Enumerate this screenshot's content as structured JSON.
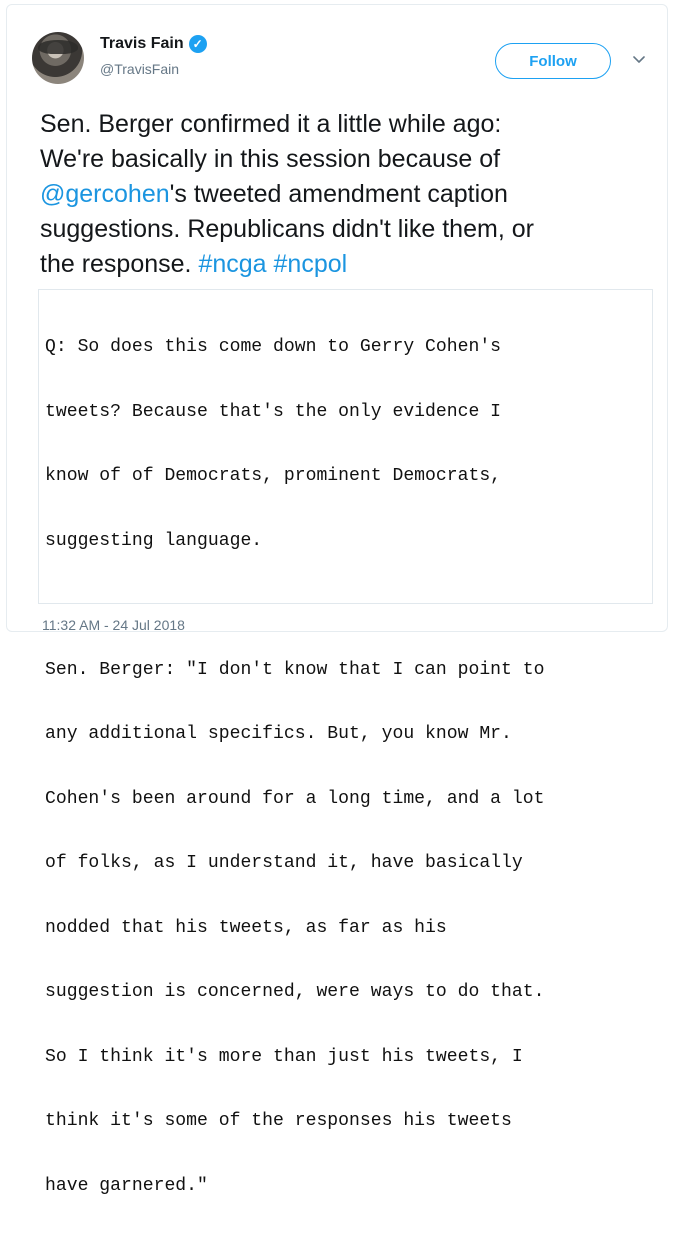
{
  "tweet": {
    "author_name": "Travis Fain",
    "author_handle": "@TravisFain",
    "follow_label": "Follow",
    "text_lines": [
      "Sen. Berger confirmed it a little while ago:",
      "We're basically in this session because of",
      "'s tweeted amendment caption",
      "suggestions. Republicans didn't like them, or",
      "the response. "
    ],
    "mention": "@gercohen",
    "hashtags": [
      "#ncga",
      "#ncpol"
    ],
    "quote_lines": [
      "Q: So does this come down to Gerry Cohen's",
      "tweets? Because that's the only evidence I",
      "know of of Democrats, prominent Democrats,",
      "suggesting language.",
      "",
      "Sen. Berger: \"I don't know that I can point to",
      "any additional specifics. But, you know Mr.",
      "Cohen's been around for a long time, and a lot",
      "of folks, as I understand it, have basically",
      "nodded that his tweets, as far as his",
      "suggestion is concerned, were ways to do that.",
      "So I think it's more than just his tweets, I",
      "think it's some of the responses his tweets",
      "have garnered.\""
    ],
    "timestamp": "11:32 AM - 24 Jul 2018"
  },
  "icons": {
    "verified": "verified-badge-icon",
    "more": "chevron-down-icon"
  },
  "colors": {
    "accent": "#1da1f2",
    "link": "#1b95e0",
    "secondary_text": "#657786"
  }
}
